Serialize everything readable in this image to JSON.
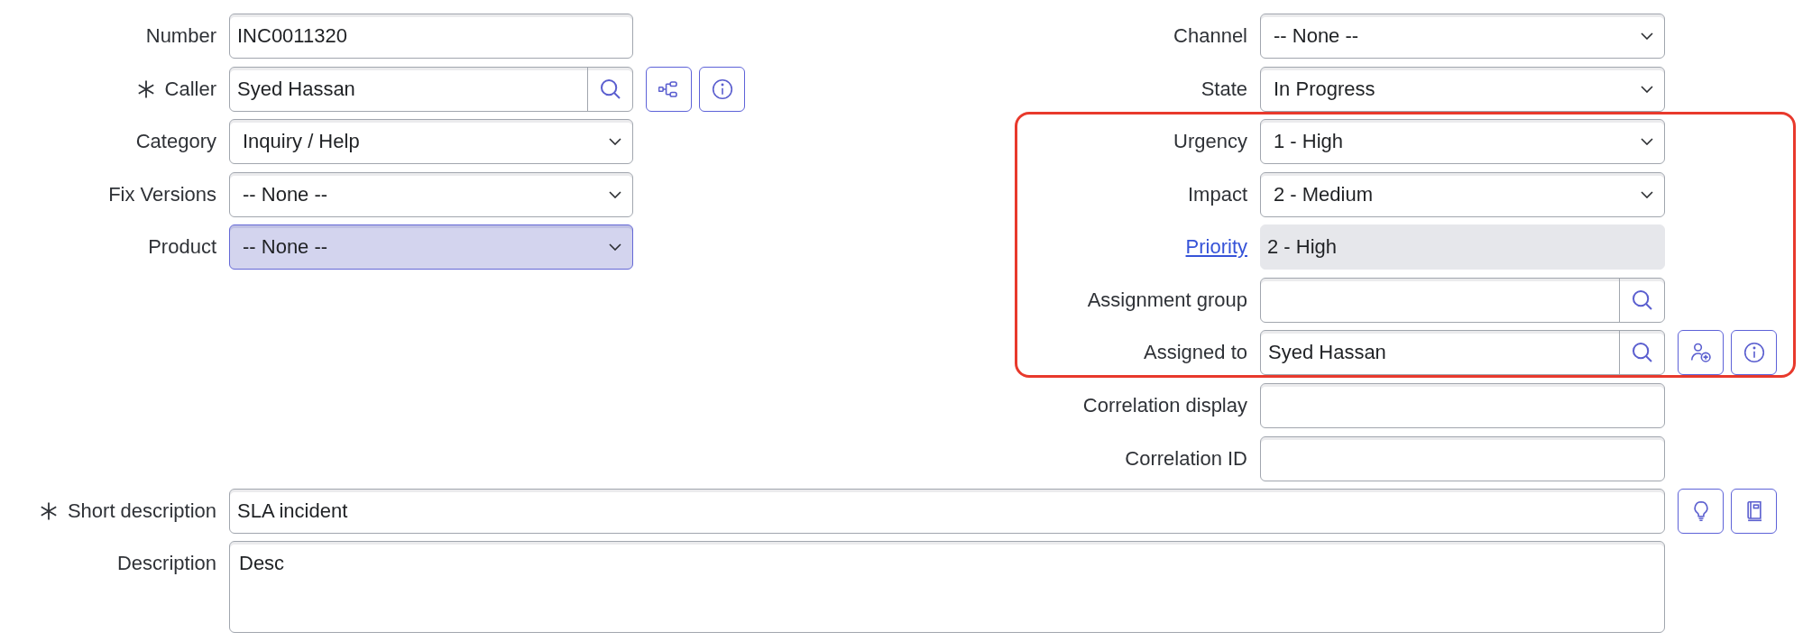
{
  "left_fields": [
    {
      "label": "Number",
      "kind": "text",
      "value": "INC0011320",
      "mandatory": false,
      "focused": false
    },
    {
      "label": "Caller",
      "kind": "reference",
      "value": "Syed Hassan",
      "mandatory": true,
      "focused": false,
      "actions": [
        {
          "kind": "hierarchy"
        },
        {
          "kind": "info"
        }
      ]
    },
    {
      "label": "Category",
      "kind": "select",
      "value": "Inquiry / Help",
      "mandatory": false,
      "focused": false
    },
    {
      "label": "Fix Versions",
      "kind": "select",
      "value": "-- None --",
      "mandatory": false,
      "focused": false
    },
    {
      "label": "Product",
      "kind": "select",
      "value": "-- None --",
      "mandatory": false,
      "focused": true
    }
  ],
  "right_groups": [
    {
      "highlighted": false,
      "fields": [
        {
          "label": "Channel",
          "kind": "select",
          "value": "-- None --",
          "label_link": false
        },
        {
          "label": "State",
          "kind": "select",
          "value": "In Progress",
          "label_link": false
        }
      ]
    },
    {
      "highlighted": true,
      "fields": [
        {
          "label": "Urgency",
          "kind": "select",
          "value": "1 - High",
          "label_link": false
        },
        {
          "label": "Impact",
          "kind": "select",
          "value": "2 - Medium",
          "label_link": false
        },
        {
          "label": "Priority",
          "kind": "readonly",
          "value": "2 - High",
          "label_link": true
        },
        {
          "label": "Assignment group",
          "kind": "reference",
          "label_link": false
        },
        {
          "label": "Assigned to",
          "kind": "reference",
          "value": "Syed Hassan",
          "label_link": false,
          "actions": [
            {
              "kind": "add_user"
            },
            {
              "kind": "info"
            }
          ]
        }
      ]
    },
    {
      "highlighted": false,
      "fields": [
        {
          "label": "Correlation display",
          "kind": "text",
          "label_link": false
        },
        {
          "label": "Correlation ID",
          "kind": "text",
          "label_link": false
        }
      ]
    }
  ],
  "bottom_fields": [
    {
      "label": "Short description",
      "kind": "text",
      "value": "SLA incident",
      "mandatory": true,
      "actions": [
        {
          "kind": "suggest"
        },
        {
          "kind": "knowledge"
        }
      ]
    },
    {
      "label": "Description",
      "kind": "textarea",
      "value": "Desc",
      "mandatory": false
    }
  ]
}
